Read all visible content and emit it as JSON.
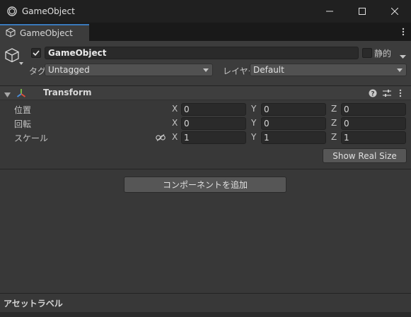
{
  "window": {
    "title": "GameObject"
  },
  "tab": {
    "label": "GameObject"
  },
  "header": {
    "active": true,
    "name": "GameObject",
    "static_label": "静的",
    "tag_label": "タグ",
    "tag_value": "Untagged",
    "layer_label": "レイヤー",
    "layer_value": "Default"
  },
  "transform": {
    "title": "Transform",
    "rows": [
      {
        "label": "位置",
        "x": "0",
        "y": "0",
        "z": "0"
      },
      {
        "label": "回転",
        "x": "0",
        "y": "0",
        "z": "0"
      },
      {
        "label": "スケール",
        "x": "1",
        "y": "1",
        "z": "1"
      }
    ],
    "axis_x": "X",
    "axis_y": "Y",
    "axis_z": "Z",
    "show_real_size": "Show Real Size"
  },
  "add_component": "コンポーネントを追加",
  "asset_labels": "アセットラベル",
  "colors": {
    "accent": "#3a79bb",
    "background": "#383838",
    "field": "#2a2a2a"
  }
}
